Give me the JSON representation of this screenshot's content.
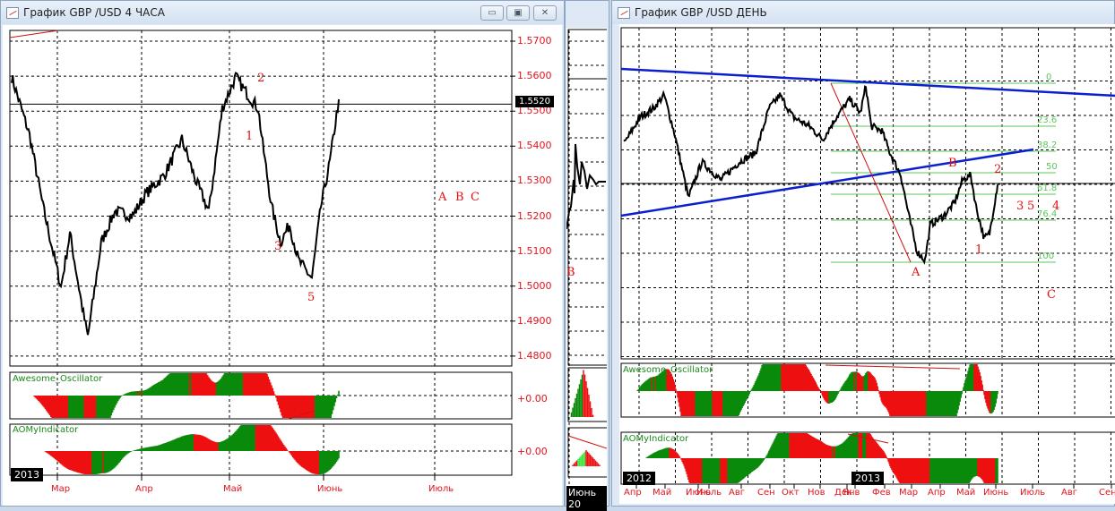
{
  "left_window": {
    "title": "График GBP /USD  4 ЧАСА",
    "buttons": {
      "minimize": "▭",
      "restore": "▣",
      "close": "✕"
    },
    "price_labels": [
      "1.5700",
      "1.5600",
      "1.5500",
      "1.5400",
      "1.5300",
      "1.5200",
      "1.5100",
      "1.5000",
      "1.4900",
      "1.4800"
    ],
    "current_price": "1.5520",
    "month_labels": [
      "Мар",
      "Апр",
      "Май",
      "Июнь",
      "Июль"
    ],
    "year_tag": "2013",
    "indicators": [
      {
        "name": "Awesome_Oscillator",
        "zero": "+0.00"
      },
      {
        "name": "AOMyIndicator",
        "zero": "+0.00"
      }
    ],
    "wave_labels": {
      "w1": "1",
      "w2": "2",
      "w3": "3",
      "w5": "5",
      "a": "A",
      "b": "B",
      "c": "C"
    },
    "price_series": [
      [
        0,
        1.5598
      ],
      [
        4,
        1.5431
      ],
      [
        7,
        1.5227
      ],
      [
        11,
        1.4997
      ],
      [
        13,
        1.515
      ],
      [
        16,
        1.492
      ],
      [
        17,
        1.4856
      ],
      [
        20,
        1.5125
      ],
      [
        23,
        1.5214
      ],
      [
        27,
        1.5201
      ],
      [
        30,
        1.5265
      ],
      [
        34,
        1.5316
      ],
      [
        38,
        1.5419
      ],
      [
        41,
        1.5304
      ],
      [
        44,
        1.5214
      ],
      [
        47,
        1.5508
      ],
      [
        50,
        1.5598
      ],
      [
        52,
        1.5559
      ],
      [
        55,
        1.5508
      ],
      [
        56,
        1.5406
      ],
      [
        58,
        1.5227
      ],
      [
        60,
        1.5125
      ],
      [
        62,
        1.5176
      ],
      [
        64,
        1.5073
      ],
      [
        67,
        1.5022
      ],
      [
        69,
        1.5227
      ],
      [
        71,
        1.5355
      ],
      [
        73,
        1.5534
      ]
    ]
  },
  "middle_window": {
    "wave_label": "B",
    "date_label": "Июнь 20"
  },
  "right_window": {
    "title": "График GBP /USD  ДЕНЬ",
    "month_labels": [
      "Апр",
      "Май",
      "Июнь",
      "Июль",
      "Авг",
      "Сен",
      "Окт",
      "Нов",
      "Дек",
      "Янв",
      "Фев",
      "Мар",
      "Апр",
      "Май",
      "Июнь",
      "Июль",
      "Авг",
      "Сен"
    ],
    "year_tags": [
      "2012",
      "2013"
    ],
    "indicators": [
      {
        "name": "Awesome_Oscillator"
      },
      {
        "name": "AOMyIndicator"
      }
    ],
    "fib_levels": [
      "0",
      "23.6",
      "38.2",
      "50",
      "61.8",
      "76.4",
      "100"
    ],
    "wave_labels": {
      "a": "A",
      "b": "B",
      "c": "C",
      "w1": "1",
      "w2": "2",
      "w3": "3",
      "w4": "4",
      "w5": "5"
    },
    "price_series": [
      [
        0,
        1.579
      ],
      [
        6,
        1.6015
      ],
      [
        11,
        1.609
      ],
      [
        15,
        1.62
      ],
      [
        19,
        1.5865
      ],
      [
        24,
        1.534
      ],
      [
        29,
        1.564
      ],
      [
        36,
        1.549
      ],
      [
        43,
        1.564
      ],
      [
        49,
        1.5715
      ],
      [
        54,
        1.609
      ],
      [
        58,
        1.62
      ],
      [
        63,
        1.6015
      ],
      [
        69,
        1.594
      ],
      [
        74,
        1.5828
      ],
      [
        79,
        1.6015
      ],
      [
        84,
        1.6165
      ],
      [
        88,
        1.605
      ],
      [
        90,
        1.628
      ],
      [
        92,
        1.594
      ],
      [
        96,
        1.59
      ],
      [
        99,
        1.5715
      ],
      [
        103,
        1.553
      ],
      [
        106,
        1.519
      ],
      [
        109,
        1.489
      ],
      [
        112,
        1.4815
      ],
      [
        114,
        1.5115
      ],
      [
        119,
        1.519
      ],
      [
        123,
        1.53
      ],
      [
        126,
        1.549
      ],
      [
        129,
        1.553
      ],
      [
        131,
        1.5265
      ],
      [
        134,
        1.5
      ],
      [
        136,
        1.504
      ],
      [
        139,
        1.545
      ]
    ]
  }
}
